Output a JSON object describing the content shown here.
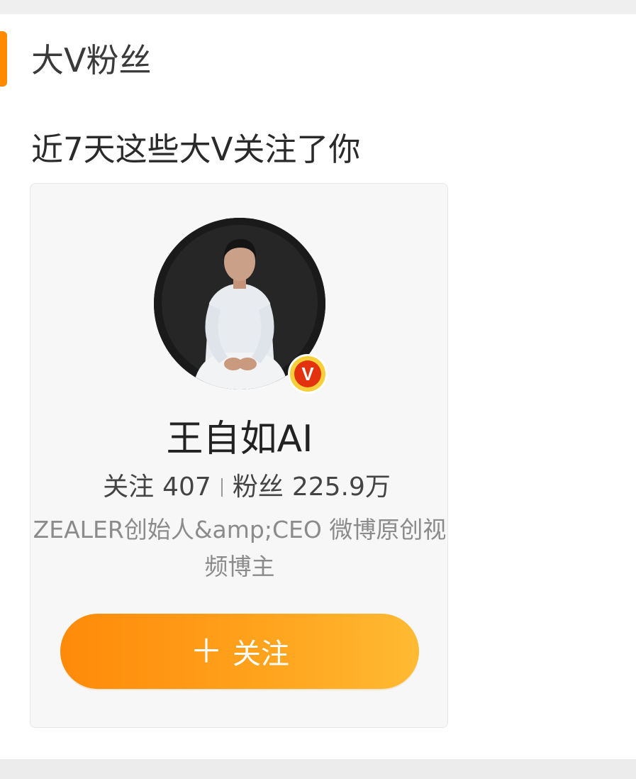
{
  "section": {
    "title": "大V粉丝"
  },
  "subtitle": "近7天这些大V关注了你",
  "card": {
    "name": "王自如AI",
    "following_label": "关注",
    "following_count": "407",
    "followers_label": "粉丝",
    "followers_count": "225.9万",
    "description": "ZEALER创始人&amp;CEO 微博原创视频博主",
    "badge_icon": "v-verified-icon",
    "badge_letter": "V",
    "follow_button": {
      "icon": "plus-icon",
      "label": "关注"
    }
  },
  "colors": {
    "accent": "#ff8a00",
    "button_start": "#ff8a0a",
    "button_end": "#ffba33",
    "badge_outer": "#f6cf3a",
    "badge_inner": "#e2320f"
  }
}
